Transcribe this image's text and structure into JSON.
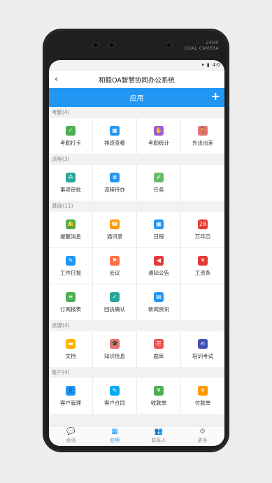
{
  "device": {
    "camera_label_1": "24MP",
    "camera_label_2": "DUAL CAMERA"
  },
  "status_bar": {
    "time": "4:0"
  },
  "header": {
    "back_icon": "chevron-left-icon",
    "title": "和毅OA智慧协同办公系统"
  },
  "app_bar": {
    "title": "应用",
    "add_icon": "plus-icon"
  },
  "sections": [
    {
      "title": "考勤(4)",
      "items": [
        {
          "label": "考勤打卡",
          "icon": "fingerprint-icon",
          "color": "#4caf50",
          "glyph": "✓"
        },
        {
          "label": "排班查看",
          "icon": "calendar-icon",
          "color": "#2196f3",
          "glyph": "▦"
        },
        {
          "label": "考勤统计",
          "icon": "hand-icon",
          "color": "#9c5bdc",
          "glyph": "✋"
        },
        {
          "label": "外出出差",
          "icon": "person-walk-icon",
          "color": "#e57373",
          "glyph": "🚶"
        }
      ]
    },
    {
      "title": "流程(3)",
      "items": [
        {
          "label": "事项审批",
          "icon": "flow-icon",
          "color": "#26a69a",
          "glyph": "⁂"
        },
        {
          "label": "流程待办",
          "icon": "document-list-icon",
          "color": "#2196f3",
          "glyph": "≣"
        },
        {
          "label": "任务",
          "icon": "task-check-icon",
          "color": "#66bb6a",
          "glyph": "✔"
        }
      ]
    },
    {
      "title": "基础(11)",
      "items": [
        {
          "label": "提醒消息",
          "icon": "bell-icon",
          "color": "#4caf50",
          "glyph": "🔔"
        },
        {
          "label": "通讯录",
          "icon": "contacts-icon",
          "color": "#ff9800",
          "glyph": "☎"
        },
        {
          "label": "日程",
          "icon": "schedule-icon",
          "color": "#2196f3",
          "glyph": "▦"
        },
        {
          "label": "万年历",
          "icon": "calendar-28-icon",
          "color": "#e53935",
          "glyph": "28"
        },
        {
          "label": "工作日报",
          "icon": "pen-icon",
          "color": "#2196f3",
          "glyph": "✎"
        },
        {
          "label": "会议",
          "icon": "meeting-icon",
          "color": "#ff7043",
          "glyph": "⚑"
        },
        {
          "label": "通知公告",
          "icon": "megaphone-icon",
          "color": "#e53935",
          "glyph": "◀"
        },
        {
          "label": "工资条",
          "icon": "yen-icon",
          "color": "#e53935",
          "glyph": "¥"
        },
        {
          "label": "订阅报表",
          "icon": "report-icon",
          "color": "#4caf50",
          "glyph": "≡"
        },
        {
          "label": "回执确认",
          "icon": "receipt-icon",
          "color": "#26a69a",
          "glyph": "✓"
        },
        {
          "label": "新闻资讯",
          "icon": "news-icon",
          "color": "#2196f3",
          "glyph": "▤"
        }
      ]
    },
    {
      "title": "资源(4)",
      "items": [
        {
          "label": "文档",
          "icon": "folder-icon",
          "color": "#ffb300",
          "glyph": "▬"
        },
        {
          "label": "知识信息",
          "icon": "graduation-cap-icon",
          "color": "#e57373",
          "glyph": "🎓"
        },
        {
          "label": "题库",
          "icon": "question-bank-icon",
          "color": "#ef5350",
          "glyph": "☰"
        },
        {
          "label": "培训考试",
          "icon": "exam-icon",
          "color": "#3f51b5",
          "glyph": "✍"
        }
      ]
    },
    {
      "title": "客户(4)",
      "items": [
        {
          "label": "客户管理",
          "icon": "user-icon",
          "color": "#2196f3",
          "glyph": "👤"
        },
        {
          "label": "客户合同",
          "icon": "contract-icon",
          "color": "#03a9f4",
          "glyph": "✎"
        },
        {
          "label": "收款单",
          "icon": "receipt-in-icon",
          "color": "#4caf50",
          "glyph": "¥"
        },
        {
          "label": "付款单",
          "icon": "receipt-out-icon",
          "color": "#ff9800",
          "glyph": "¥"
        }
      ]
    }
  ],
  "tabbar": [
    {
      "label": "会话",
      "icon": "chat-icon",
      "glyph": "💬",
      "active": false
    },
    {
      "label": "应用",
      "icon": "grid-icon",
      "glyph": "▦",
      "active": true
    },
    {
      "label": "联系人",
      "icon": "contacts-group-icon",
      "glyph": "👥",
      "active": false
    },
    {
      "label": "更多",
      "icon": "gear-icon",
      "glyph": "⚙",
      "active": false
    }
  ]
}
